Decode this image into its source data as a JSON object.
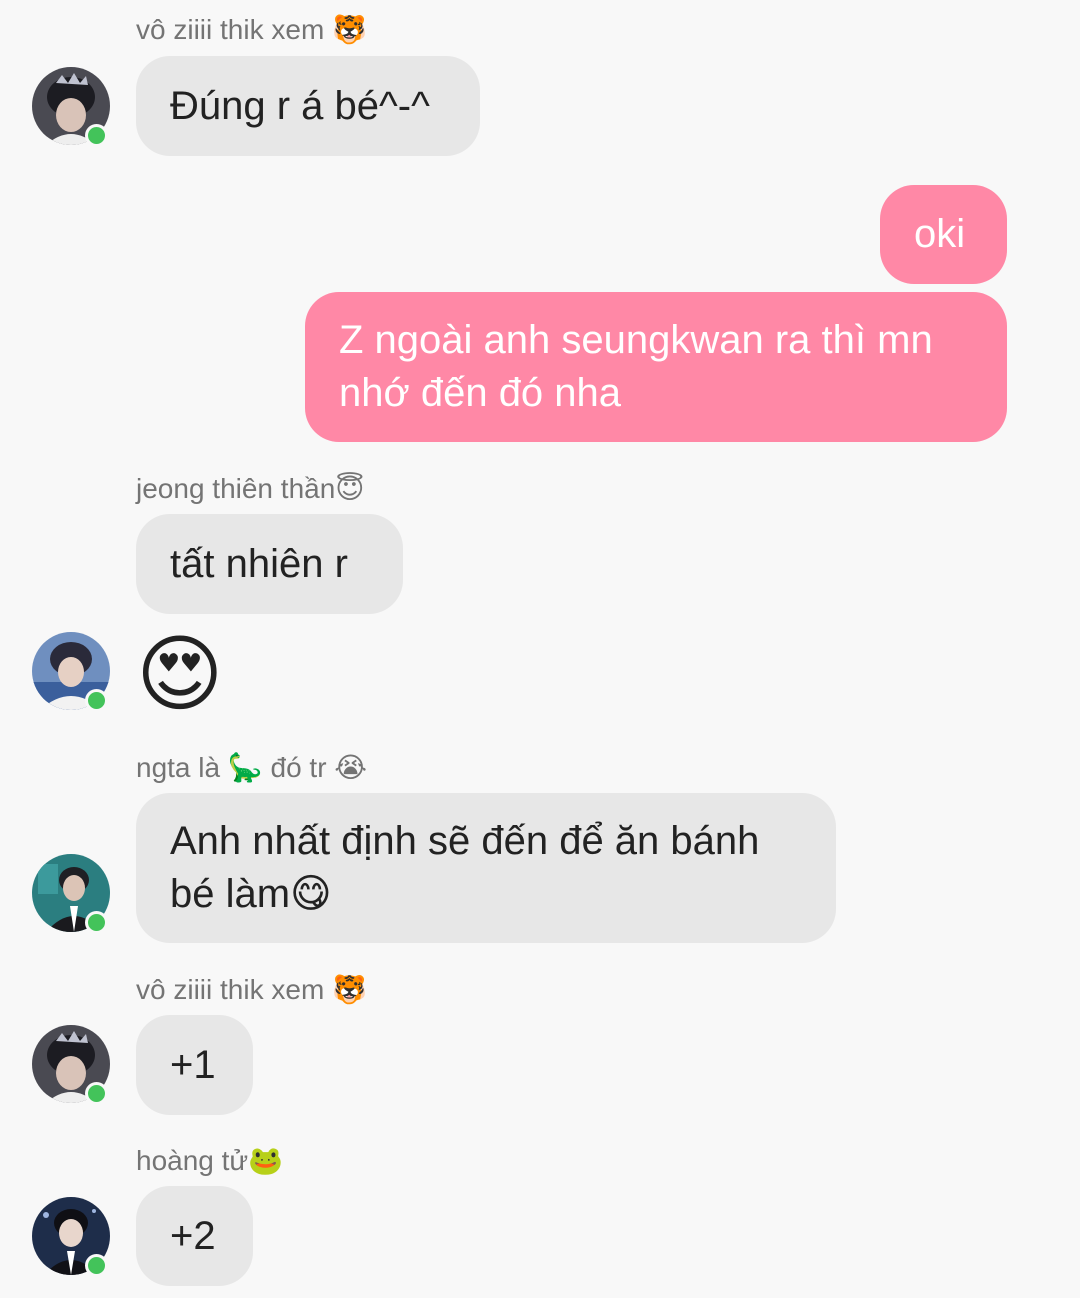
{
  "messages": [
    {
      "sender": "vô ziiii thik xem 🐯",
      "text": "Đúng r á bé^-^"
    },
    {
      "text": "oki"
    },
    {
      "text": "Z ngoài anh seungkwan ra thì mn nhớ đến đó nha"
    },
    {
      "sender": "jeong thiên thần😇",
      "text": "tất nhiên r",
      "emoji": "😍"
    },
    {
      "sender": "ngta là 🦕 đó tr 😭",
      "text": "Anh nhất định sẽ đến để ăn bánh bé làm😋"
    },
    {
      "sender": "vô ziiii thik xem 🐯",
      "text": "+1"
    },
    {
      "sender": "hoàng tử🐸",
      "text": "+2"
    }
  ],
  "colors": {
    "outgoing_bubble": "#ff88a6",
    "incoming_bubble": "#e7e7e7",
    "online_dot": "#43c35a"
  }
}
